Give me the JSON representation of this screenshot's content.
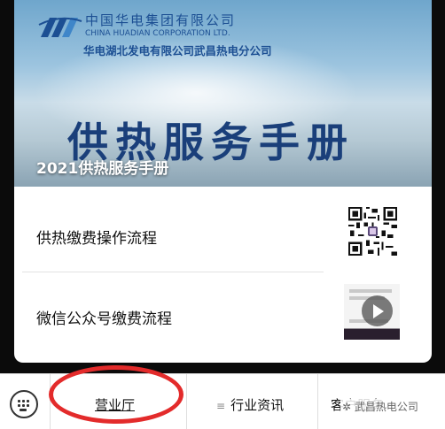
{
  "banner": {
    "company_cn": "中国华电集团有限公司",
    "company_en": "CHINA HUADIAN CORPORATION LTD.",
    "branch": "华电湖北发电有限公司武昌热电分公司",
    "big_title": "供热服务手册",
    "caption": "2021供热服务手册"
  },
  "items": [
    {
      "label": "供热缴费操作流程",
      "media": "qr-code"
    },
    {
      "label": "微信公众号缴费流程",
      "media": "video-thumbnail"
    }
  ],
  "bottom_nav": {
    "keyboard_icon": "keyboard-icon",
    "tabs": [
      "营业厅",
      "行业资讯",
      "客户服务"
    ]
  },
  "watermark": "武昌热电公司",
  "colors": {
    "brand_blue": "#1c4f93",
    "highlight_red": "#e32b2b"
  }
}
